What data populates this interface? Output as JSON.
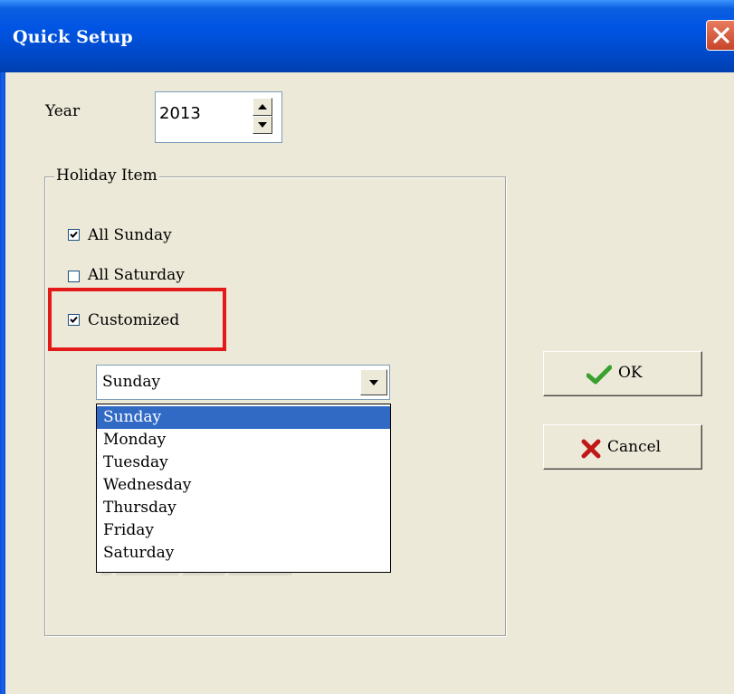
{
  "window": {
    "title": "Quick Setup"
  },
  "year": {
    "label": "Year",
    "value": "2013"
  },
  "holiday_group": {
    "title": "Holiday Item",
    "items": [
      {
        "label": "All Sunday",
        "checked": true
      },
      {
        "label": "All Saturday",
        "checked": false
      },
      {
        "label": "Customized",
        "checked": true
      }
    ]
  },
  "day_select": {
    "selected": "Sunday",
    "options": [
      "Sunday",
      "Monday",
      "Tuesday",
      "Wednesday",
      "Thursday",
      "Friday",
      "Saturday"
    ],
    "highlighted_index": 0
  },
  "buttons": {
    "ok": "OK",
    "cancel": "Cancel"
  },
  "colors": {
    "titlebar": "#0054e3",
    "dialog_bg": "#ece9d8",
    "highlight_box": "#e31a1a",
    "selection": "#316ac5",
    "ok_icon": "#3aa130",
    "cancel_icon": "#c01818"
  },
  "icons": {
    "close": "close-icon",
    "ok": "checkmark-icon",
    "cancel": "x-icon",
    "spin_up": "spin-up-arrow-icon",
    "spin_down": "spin-down-arrow-icon",
    "dropdown": "chevron-down-icon"
  }
}
